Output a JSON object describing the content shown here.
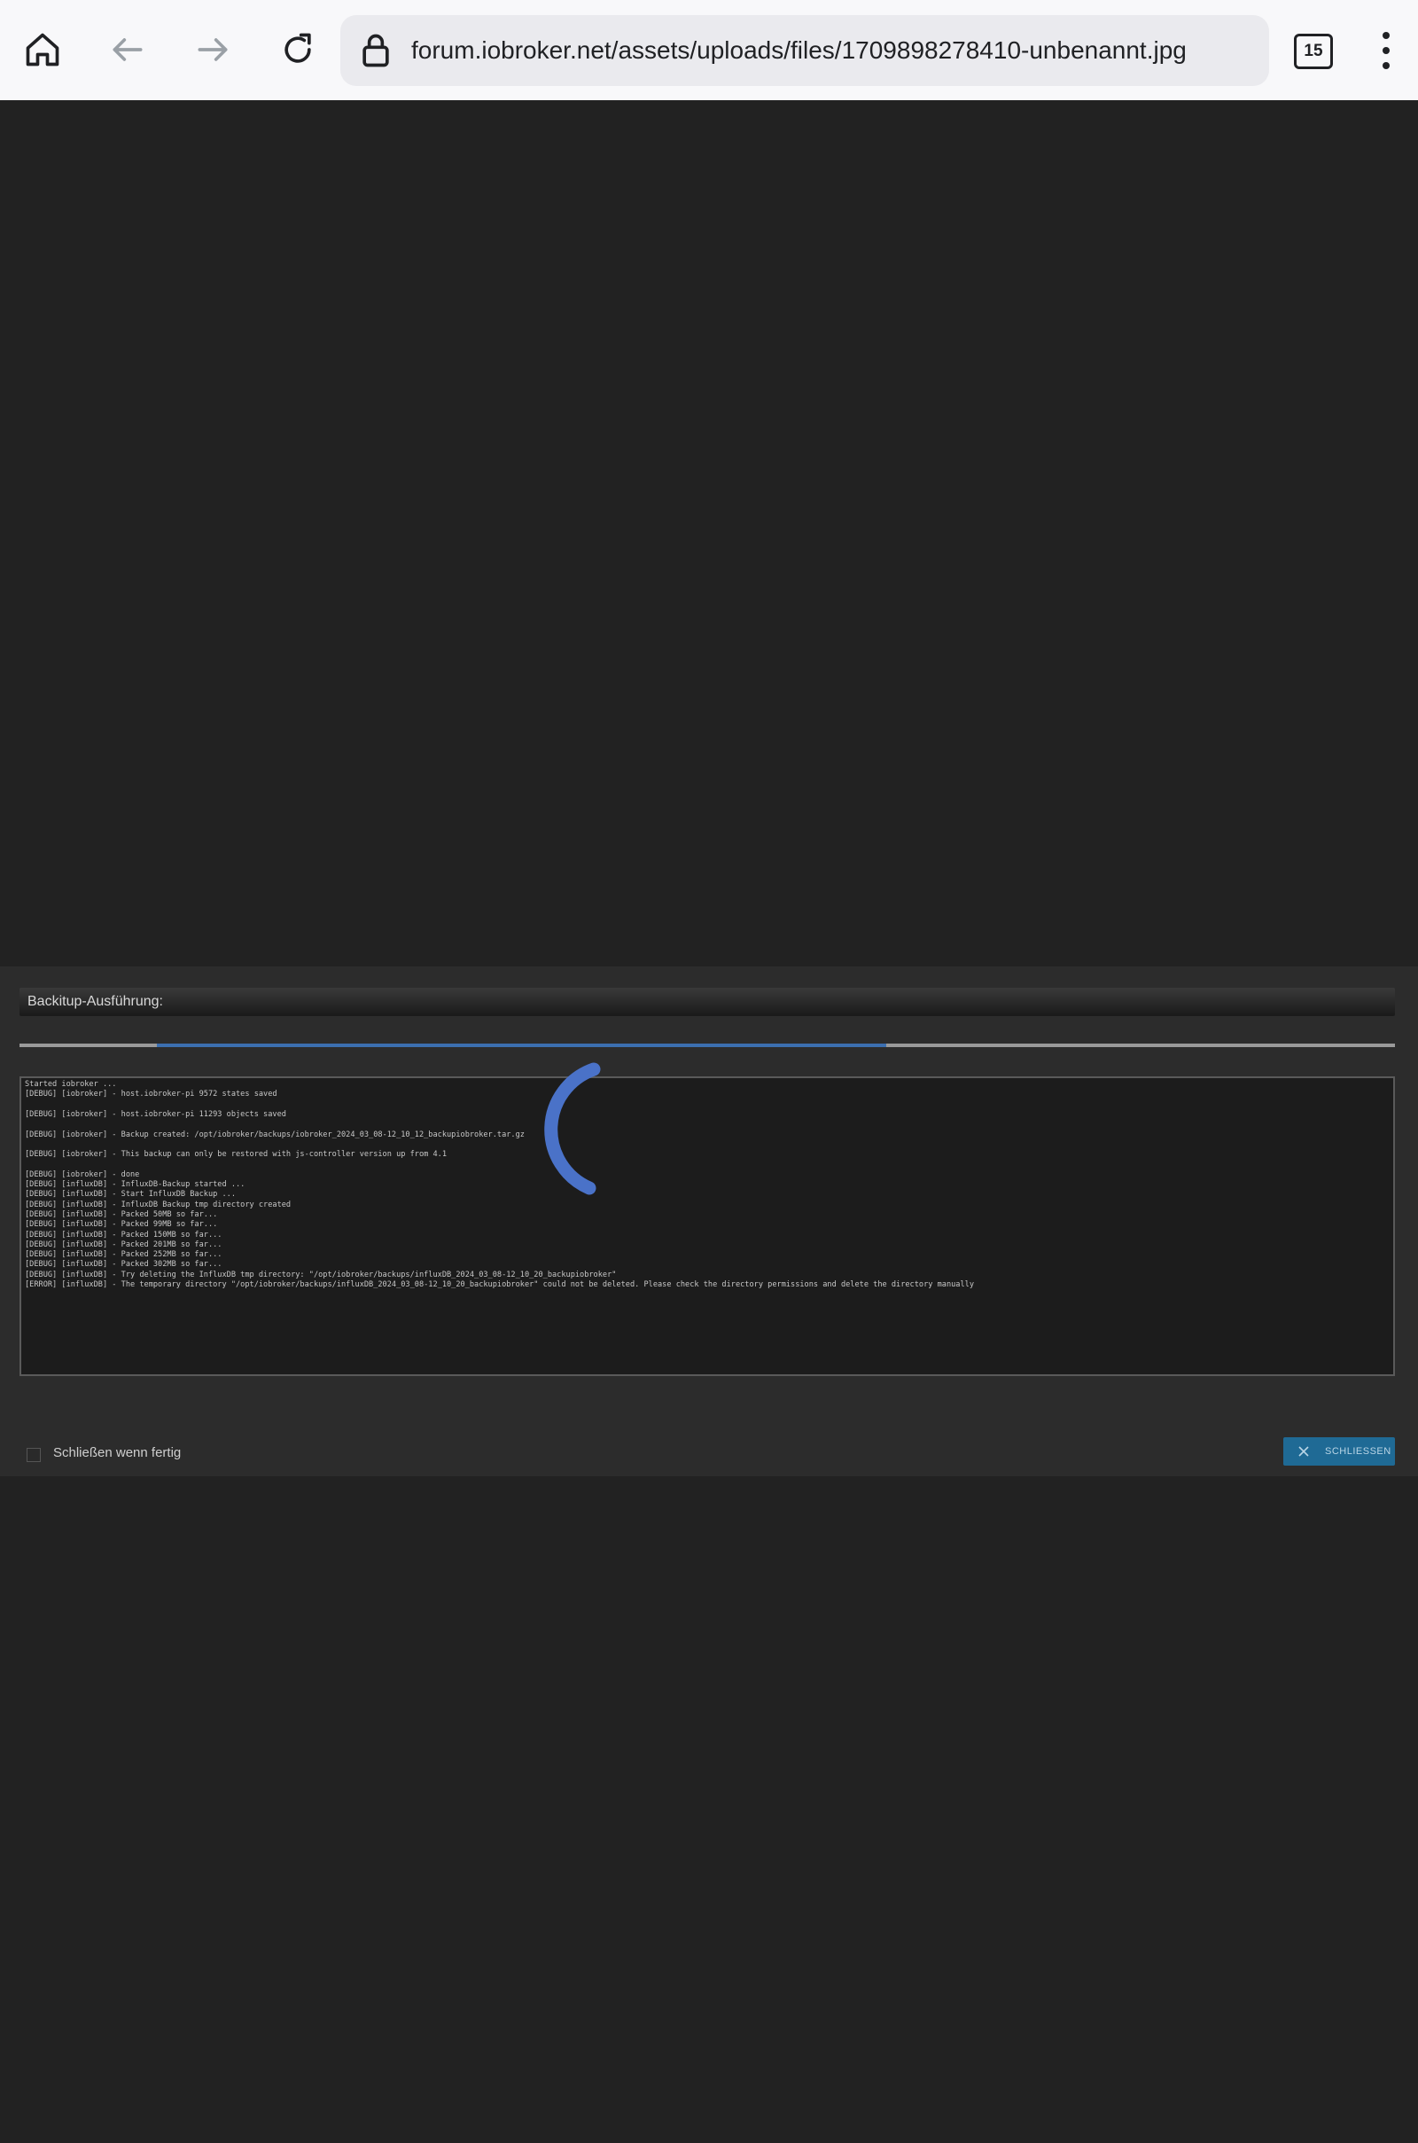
{
  "browser": {
    "url": "forum.iobroker.net/assets/uploads/files/1709898278410-unbenannt.jpg",
    "tabs_count": "15",
    "icons": [
      "home-icon",
      "back-icon",
      "forward-icon",
      "reload-icon",
      "lock-icon",
      "tabs-icon",
      "more-icon"
    ]
  },
  "dialog": {
    "title": "Backitup-Ausführung:",
    "progress": 0.53,
    "log_lines": [
      "Started iobroker ...",
      "[DEBUG] [iobroker] - host.iobroker-pi 9572 states saved",
      "",
      "[DEBUG] [iobroker] - host.iobroker-pi 11293 objects saved",
      "",
      "[DEBUG] [iobroker] - Backup created: /opt/iobroker/backups/iobroker_2024_03_08-12_10_12_backupiobroker.tar.gz",
      "",
      "[DEBUG] [iobroker] - This backup can only be restored with js-controller version up from 4.1",
      "",
      "[DEBUG] [iobroker] - done",
      "[DEBUG] [influxDB] - InfluxDB-Backup started ...",
      "[DEBUG] [influxDB] - Start InfluxDB Backup ...",
      "[DEBUG] [influxDB] - InfluxDB Backup tmp directory created",
      "[DEBUG] [influxDB] - Packed 50MB so far...",
      "[DEBUG] [influxDB] - Packed 99MB so far...",
      "[DEBUG] [influxDB] - Packed 150MB so far...",
      "[DEBUG] [influxDB] - Packed 201MB so far...",
      "[DEBUG] [influxDB] - Packed 252MB so far...",
      "[DEBUG] [influxDB] - Packed 302MB so far...",
      "[DEBUG] [influxDB] - Try deleting the InfluxDB tmp directory: \"/opt/iobroker/backups/influxDB_2024_03_08-12_10_20_backupiobroker\"",
      "[ERROR] [influxDB] - The temporary directory \"/opt/iobroker/backups/influxDB_2024_03_08-12_10_20_backupiobroker\" could not be deleted. Please check the directory permissions and delete the directory manually"
    ],
    "close_when_done_label": "Schließen wenn fertig",
    "close_when_done_checked": false,
    "close_button_label": "SCHLIESSEN",
    "accent_color": "#1f6a95",
    "progress_color": "#3c6fb0",
    "spinner_color": "#4a72c8"
  }
}
